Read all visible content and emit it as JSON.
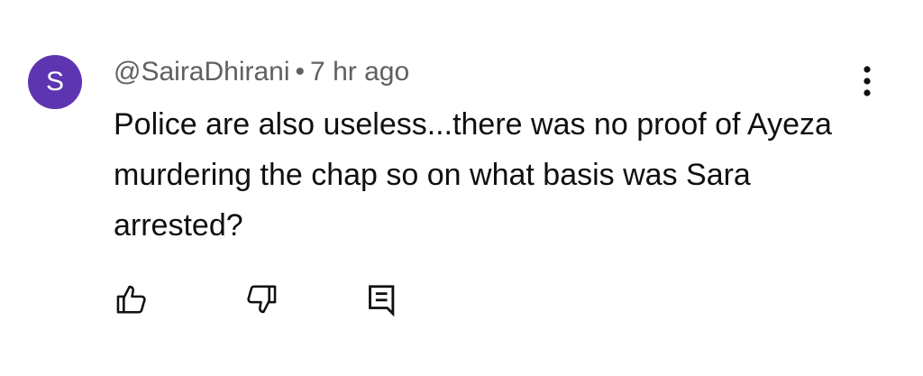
{
  "comment": {
    "avatar_letter": "S",
    "avatar_color": "#5e35b1",
    "author": "@SairaDhirani",
    "separator": "•",
    "timestamp": "7 hr ago",
    "text": "Police are also useless...there was no proof of Ayeza murdering the chap so on what basis was Sara arrested?"
  },
  "icons": {
    "more": "vertical-ellipsis-icon",
    "like": "thumbs-up-icon",
    "dislike": "thumbs-down-icon",
    "reply": "reply-comment-icon"
  }
}
